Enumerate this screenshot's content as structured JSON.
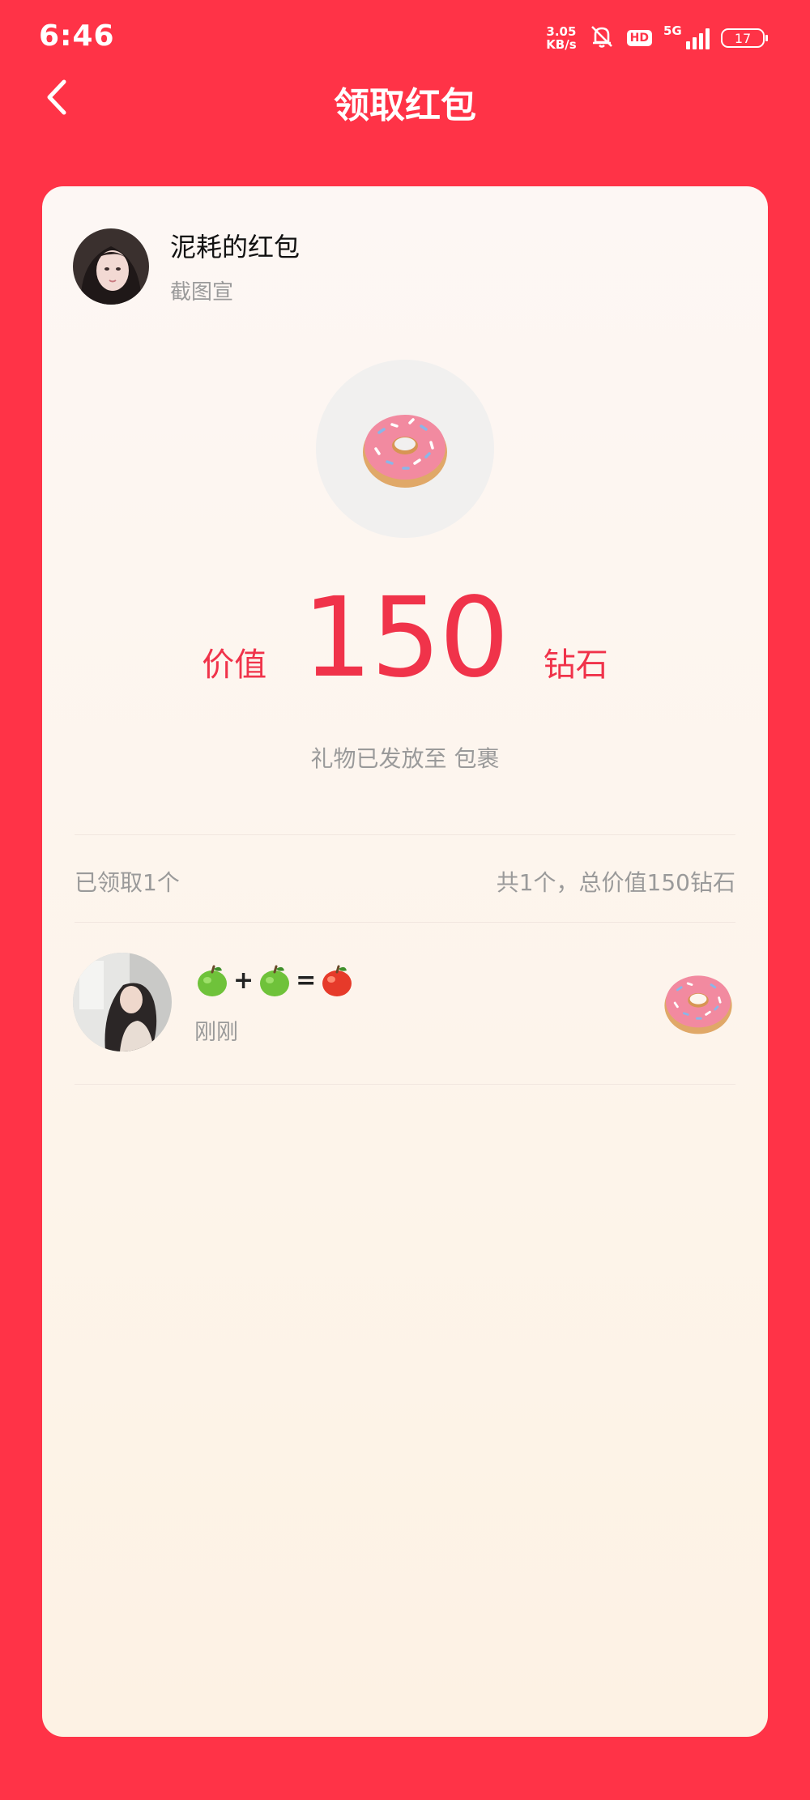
{
  "status_bar": {
    "time": "6:46",
    "net_speed_value": "3.05",
    "net_speed_unit": "KB/s",
    "hd": "HD",
    "network": "5G",
    "battery": "17"
  },
  "header": {
    "title": "领取红包"
  },
  "sender": {
    "title": "泥耗的红包",
    "subtitle": "截图宣"
  },
  "reward": {
    "prefix": "价值",
    "amount": "150",
    "unit": "钻石",
    "status": "礼物已发放至 包裹"
  },
  "summary": {
    "claimed": "已领取1个",
    "total": "共1个，总价值150钻石"
  },
  "receivers": [
    {
      "name_parts": [
        "+",
        "="
      ],
      "time": "刚刚"
    }
  ],
  "colors": {
    "background": "#ff3347",
    "accent": "#f0334a",
    "muted": "#9a9a9a"
  }
}
